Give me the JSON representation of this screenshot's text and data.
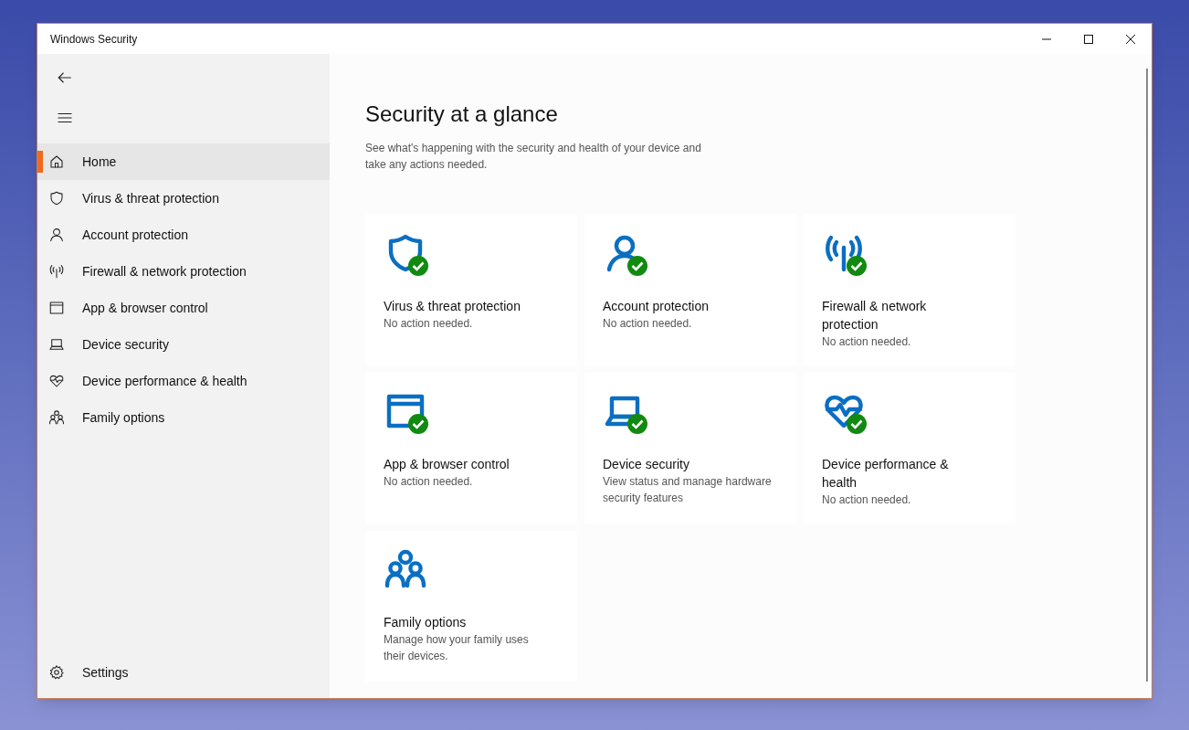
{
  "window": {
    "title": "Windows Security"
  },
  "sidebar": {
    "items": [
      {
        "label": "Home",
        "kind": "home",
        "selected": true
      },
      {
        "label": "Virus & threat protection",
        "kind": "shield",
        "selected": false
      },
      {
        "label": "Account protection",
        "kind": "person",
        "selected": false
      },
      {
        "label": "Firewall & network protection",
        "kind": "antenna",
        "selected": false
      },
      {
        "label": "App & browser control",
        "kind": "browser",
        "selected": false
      },
      {
        "label": "Device security",
        "kind": "laptop",
        "selected": false
      },
      {
        "label": "Device performance & health",
        "kind": "heart",
        "selected": false
      },
      {
        "label": "Family options",
        "kind": "family",
        "selected": false
      }
    ],
    "settings": {
      "label": "Settings"
    }
  },
  "page": {
    "title": "Security at a glance",
    "subtitle": "See what's happening with the security and health of your device and take any actions needed."
  },
  "tiles": [
    {
      "title": "Virus & threat protection",
      "status": "No action needed.",
      "kind": "shield",
      "ok": true
    },
    {
      "title": "Account protection",
      "status": "No action needed.",
      "kind": "person",
      "ok": true
    },
    {
      "title": "Firewall & network protection",
      "status": "No action needed.",
      "kind": "antenna",
      "ok": true
    },
    {
      "title": "App & browser control",
      "status": "No action needed.",
      "kind": "browser",
      "ok": true
    },
    {
      "title": "Device security",
      "status": "View status and manage hardware security features",
      "kind": "laptop",
      "ok": true
    },
    {
      "title": "Device performance & health",
      "status": "No action needed.",
      "kind": "heart",
      "ok": true
    },
    {
      "title": "Family options",
      "status": "Manage how your family uses their devices.",
      "kind": "family",
      "ok": false
    }
  ]
}
